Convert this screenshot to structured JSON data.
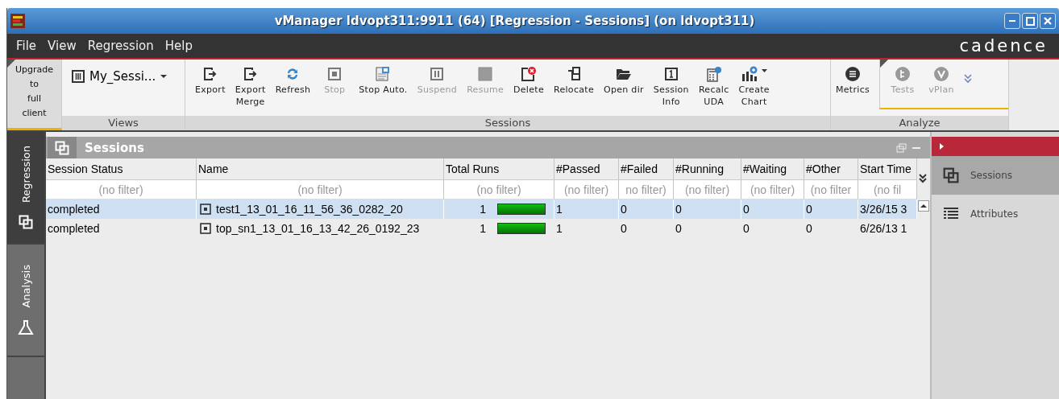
{
  "window": {
    "title": "vManager ldvopt311:9911 (64) [Regression - Sessions] (on ldvopt311)"
  },
  "menu": [
    "File",
    "View",
    "Regression",
    "Help"
  ],
  "brand": "cadence",
  "ribbon": {
    "upgrade": "Upgrade\nto\nfull\nclient",
    "views": {
      "label": "Views",
      "selector": "My_Sessi..."
    },
    "sessions": {
      "label": "Sessions",
      "buttons": [
        {
          "label": "Export",
          "kind": "export",
          "disabled": false,
          "menu": false
        },
        {
          "label": "Export\nMerge",
          "kind": "export",
          "disabled": false,
          "menu": false
        },
        {
          "label": "Refresh",
          "kind": "refresh",
          "disabled": false,
          "menu": false
        },
        {
          "label": "Stop",
          "kind": "stop",
          "disabled": true,
          "menu": false
        },
        {
          "label": "Stop Auto.",
          "kind": "stopauto",
          "disabled": false,
          "menu": false
        },
        {
          "label": "Suspend",
          "kind": "pause",
          "disabled": true,
          "menu": false
        },
        {
          "label": "Resume",
          "kind": "resume",
          "disabled": true,
          "menu": false
        },
        {
          "label": "Delete",
          "kind": "delete",
          "disabled": false,
          "menu": false
        },
        {
          "label": "Relocate",
          "kind": "relocate",
          "disabled": false,
          "menu": false
        },
        {
          "label": "Open dir",
          "kind": "folder",
          "disabled": false,
          "menu": false
        },
        {
          "label": "Session\nInfo",
          "kind": "info",
          "disabled": false,
          "menu": false
        },
        {
          "label": "Recalc\nUDA",
          "kind": "recalc",
          "disabled": false,
          "menu": false
        },
        {
          "label": "Create\nChart",
          "kind": "chart",
          "disabled": false,
          "menu": true
        }
      ]
    },
    "analyze": {
      "label": "Analyze",
      "buttons": [
        {
          "label": "Metrics",
          "kind": "metrics",
          "disabled": false
        },
        {
          "label": "Tests",
          "kind": "tests",
          "disabled": true
        },
        {
          "label": "vPlan",
          "kind": "vplan",
          "disabled": true
        }
      ]
    }
  },
  "side_tabs": [
    {
      "label": "Regression",
      "kind": "sessions",
      "selected": true
    },
    {
      "label": "Analysis",
      "kind": "flask",
      "selected": false
    }
  ],
  "panel": {
    "title": "Sessions",
    "table": {
      "columns": [
        "Session Status",
        "Name",
        "Total Runs",
        "#Passed",
        "#Failed",
        "#Running",
        "#Waiting",
        "#Other",
        "Start Time"
      ],
      "filters": [
        "(no filter)",
        "(no filter)",
        "(no filter)",
        "(no filter)",
        "no filter)",
        "(no filter)",
        "(no filter)",
        "(no filter",
        "(no fil"
      ],
      "rows": [
        {
          "selected": true,
          "status": "completed",
          "name": "test1_13_01_16_11_56_36_0282_20",
          "total_runs": "1",
          "level": 1,
          "passed": "1",
          "failed": "0",
          "running": "0",
          "waiting": "0",
          "other": "0",
          "start_time": "3/26/15 3"
        },
        {
          "selected": false,
          "status": "completed",
          "name": "top_sn1_13_01_16_13_42_26_0192_23",
          "total_runs": "1",
          "level": 1,
          "passed": "1",
          "failed": "0",
          "running": "0",
          "waiting": "0",
          "other": "0",
          "start_time": "6/26/13 1"
        }
      ]
    }
  },
  "right_panel": {
    "items": [
      {
        "label": "Sessions",
        "kind": "sessions",
        "selected": true
      },
      {
        "label": "Attributes",
        "kind": "list",
        "selected": false
      }
    ]
  }
}
